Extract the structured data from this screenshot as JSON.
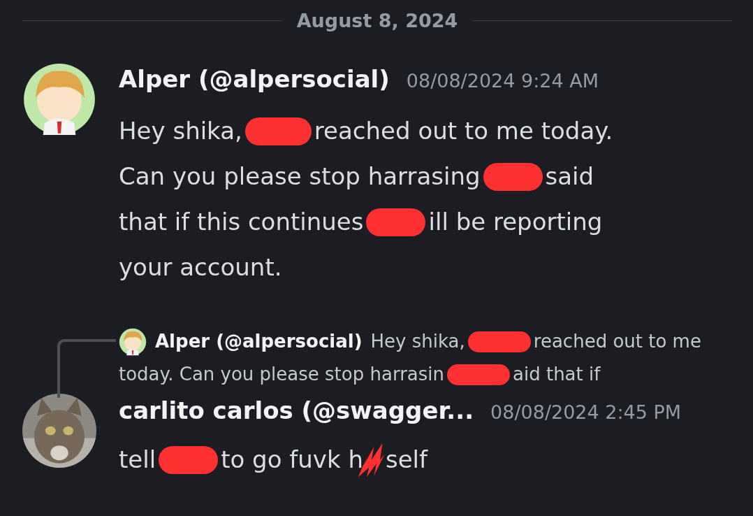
{
  "date_divider": "August 8, 2024",
  "messages": [
    {
      "kind": "message",
      "author": "Alper (@alpersocial)",
      "timestamp": "08/08/2024 9:24 AM",
      "avatar": {
        "kind": "cartoon"
      },
      "lines": [
        [
          {
            "kind": "text",
            "text": "Hey shika,"
          },
          {
            "kind": "redaction"
          },
          {
            "kind": "text",
            "text": "reached out to me today."
          }
        ],
        [
          {
            "kind": "text",
            "text": "Can you please stop harrasing"
          },
          {
            "kind": "redaction"
          },
          {
            "kind": "text",
            "text": "said"
          }
        ],
        [
          {
            "kind": "text",
            "text": "that if this continues"
          },
          {
            "kind": "redaction"
          },
          {
            "kind": "text",
            "text": "ill be reporting"
          }
        ],
        [
          {
            "kind": "text",
            "text": "your account."
          }
        ]
      ]
    },
    {
      "kind": "reply",
      "author": "Alper (@alpersocial)",
      "avatar": {
        "kind": "cartoon"
      },
      "lines": [
        [
          {
            "kind": "text",
            "text": "Hey shika,"
          },
          {
            "kind": "redaction"
          },
          {
            "kind": "text",
            "text": "reached out to me"
          }
        ],
        [
          {
            "kind": "text",
            "text": "today. Can you please stop harrasin"
          },
          {
            "kind": "redaction"
          },
          {
            "kind": "text",
            "text": "aid that if"
          }
        ]
      ]
    },
    {
      "kind": "message",
      "author": "carlito carlos (@swagger...",
      "timestamp": "08/08/2024 2:45 PM",
      "avatar": {
        "kind": "picture"
      },
      "lines": [
        [
          {
            "kind": "text",
            "text": "tell"
          },
          {
            "kind": "redaction"
          },
          {
            "kind": "text",
            "text": "to go fuvk h"
          },
          {
            "kind": "scribble"
          },
          {
            "kind": "text",
            "text": "self"
          }
        ]
      ]
    }
  ]
}
